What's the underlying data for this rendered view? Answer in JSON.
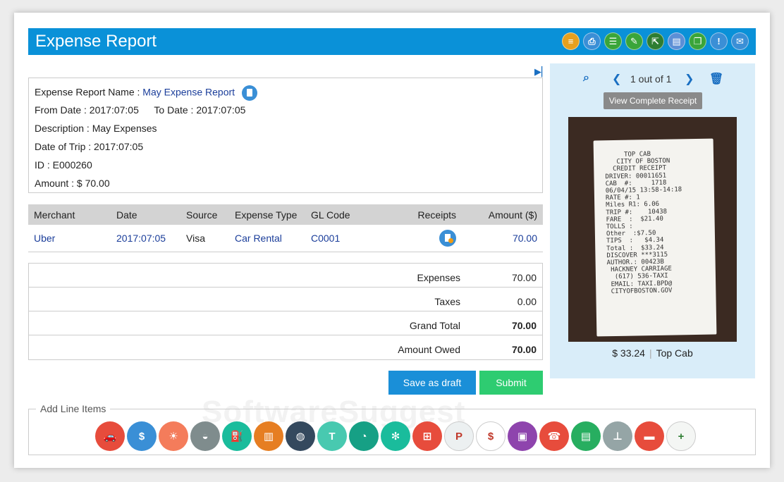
{
  "header": {
    "title": "Expense Report",
    "toolbar_icons": [
      {
        "name": "list-icon",
        "color": "#e6a01e",
        "glyph": "≡"
      },
      {
        "name": "print-icon",
        "color": "#3a8fd6",
        "glyph": "⎙"
      },
      {
        "name": "notes-icon",
        "color": "#3aa53a",
        "glyph": "☰"
      },
      {
        "name": "edit-icon",
        "color": "#3aa53a",
        "glyph": "✎"
      },
      {
        "name": "export-icon",
        "color": "#2e7d32",
        "glyph": "⇱"
      },
      {
        "name": "document-icon",
        "color": "#5c8fd6",
        "glyph": "▤"
      },
      {
        "name": "copy-icon",
        "color": "#3aa53a",
        "glyph": "❐"
      },
      {
        "name": "alert-icon",
        "color": "#3a8fd6",
        "glyph": "!"
      },
      {
        "name": "comment-icon",
        "color": "#3a8fd6",
        "glyph": "✉"
      }
    ]
  },
  "report": {
    "name_label": "Expense Report Name :",
    "name_value": "May Expense Report",
    "from_label": "From Date :",
    "from_value": "2017:07:05",
    "to_label": "To Date :",
    "to_value": "2017:07:05",
    "description_label": "Description  :",
    "description_value": "May Expenses",
    "trip_label": "Date of Trip :",
    "trip_value": "2017:07:05",
    "id_label": "ID :",
    "id_value": "E000260",
    "amount_label": "Amount :",
    "amount_value": "$ 70.00"
  },
  "line_items": {
    "headers": {
      "merchant": "Merchant",
      "date": "Date",
      "source": "Source",
      "expense_type": "Expense Type",
      "gl_code": "GL Code",
      "receipts": "Receipts",
      "amount": "Amount ($)"
    },
    "rows": [
      {
        "merchant": "Uber",
        "date": "2017:07:05",
        "source": "Visa",
        "expense_type": "Car Rental",
        "gl_code": "C0001",
        "amount": "70.00"
      }
    ]
  },
  "totals": {
    "expenses_label": "Expenses",
    "expenses_value": "70.00",
    "taxes_label": "Taxes",
    "taxes_value": "0.00",
    "grand_total_label": "Grand Total",
    "grand_total_value": "70.00",
    "amount_owed_label": "Amount Owed",
    "amount_owed_value": "70.00"
  },
  "actions": {
    "save_draft": "Save as draft",
    "submit": "Submit"
  },
  "receipt_panel": {
    "page_indicator": "1 out of 1",
    "view_button": "View Complete Receipt",
    "receipt_lines": [
      "     TOP CAB",
      "   CITY OF BOSTON",
      "",
      "  CREDIT RECEIPT",
      "",
      "DRIVER: 00011651",
      "CAB  #:     1718",
      "06/04/15 13:58-14:18",
      "RATE #: 1",
      "Miles R1: 6.06",
      "TRIP #:    10438",
      "FARE  :  $21.40",
      "TOLLS :",
      "Other  :$7.50",
      "TIPS  :   $4.34",
      "Total :  $33.24",
      "DISCOVER ***3115",
      "AUTHOR.: 00423B",
      "",
      " HACKNEY CARRIAGE",
      "  (617) 536-TAXI",
      " EMAIL: TAXI.BPD@",
      " CITYOFBOSTON.GOV"
    ],
    "caption_amount": "$ 33.24",
    "caption_merchant": "Top Cab"
  },
  "add_line_items": {
    "legend": "Add Line Items",
    "categories": [
      {
        "name": "car-icon",
        "color": "#e74c3c",
        "glyph": "🚗"
      },
      {
        "name": "money-bag-icon",
        "color": "#3a8fd6",
        "glyph": "$"
      },
      {
        "name": "beach-icon",
        "color": "#f47c5b",
        "glyph": "☀"
      },
      {
        "name": "meal-icon",
        "color": "#7f8c8d",
        "glyph": "◒"
      },
      {
        "name": "fuel-icon",
        "color": "#1abc9c",
        "glyph": "⛽"
      },
      {
        "name": "hotel-icon",
        "color": "#e67e22",
        "glyph": "▥"
      },
      {
        "name": "globe-icon",
        "color": "#34495e",
        "glyph": "◍"
      },
      {
        "name": "shirt-icon",
        "color": "#48c9b0",
        "glyph": "T"
      },
      {
        "name": "gauge-icon",
        "color": "#16a085",
        "glyph": "◔"
      },
      {
        "name": "flower-icon",
        "color": "#1abc9c",
        "glyph": "✻"
      },
      {
        "name": "calculator-icon",
        "color": "#e74c3c",
        "glyph": "⊞"
      },
      {
        "name": "parking-icon",
        "color": "#ecf0f1",
        "glyph": "P"
      },
      {
        "name": "calendar-icon",
        "color": "#ffffff",
        "glyph": "$"
      },
      {
        "name": "package-icon",
        "color": "#8e44ad",
        "glyph": "▣"
      },
      {
        "name": "phone-icon",
        "color": "#e74c3c",
        "glyph": "☎"
      },
      {
        "name": "cash-box-icon",
        "color": "#27ae60",
        "glyph": "▤"
      },
      {
        "name": "toll-icon",
        "color": "#95a5a6",
        "glyph": "⊥"
      },
      {
        "name": "bus-icon",
        "color": "#e74c3c",
        "glyph": "▬"
      },
      {
        "name": "add-icon",
        "color": "#f4f6f4",
        "glyph": "+"
      }
    ]
  }
}
